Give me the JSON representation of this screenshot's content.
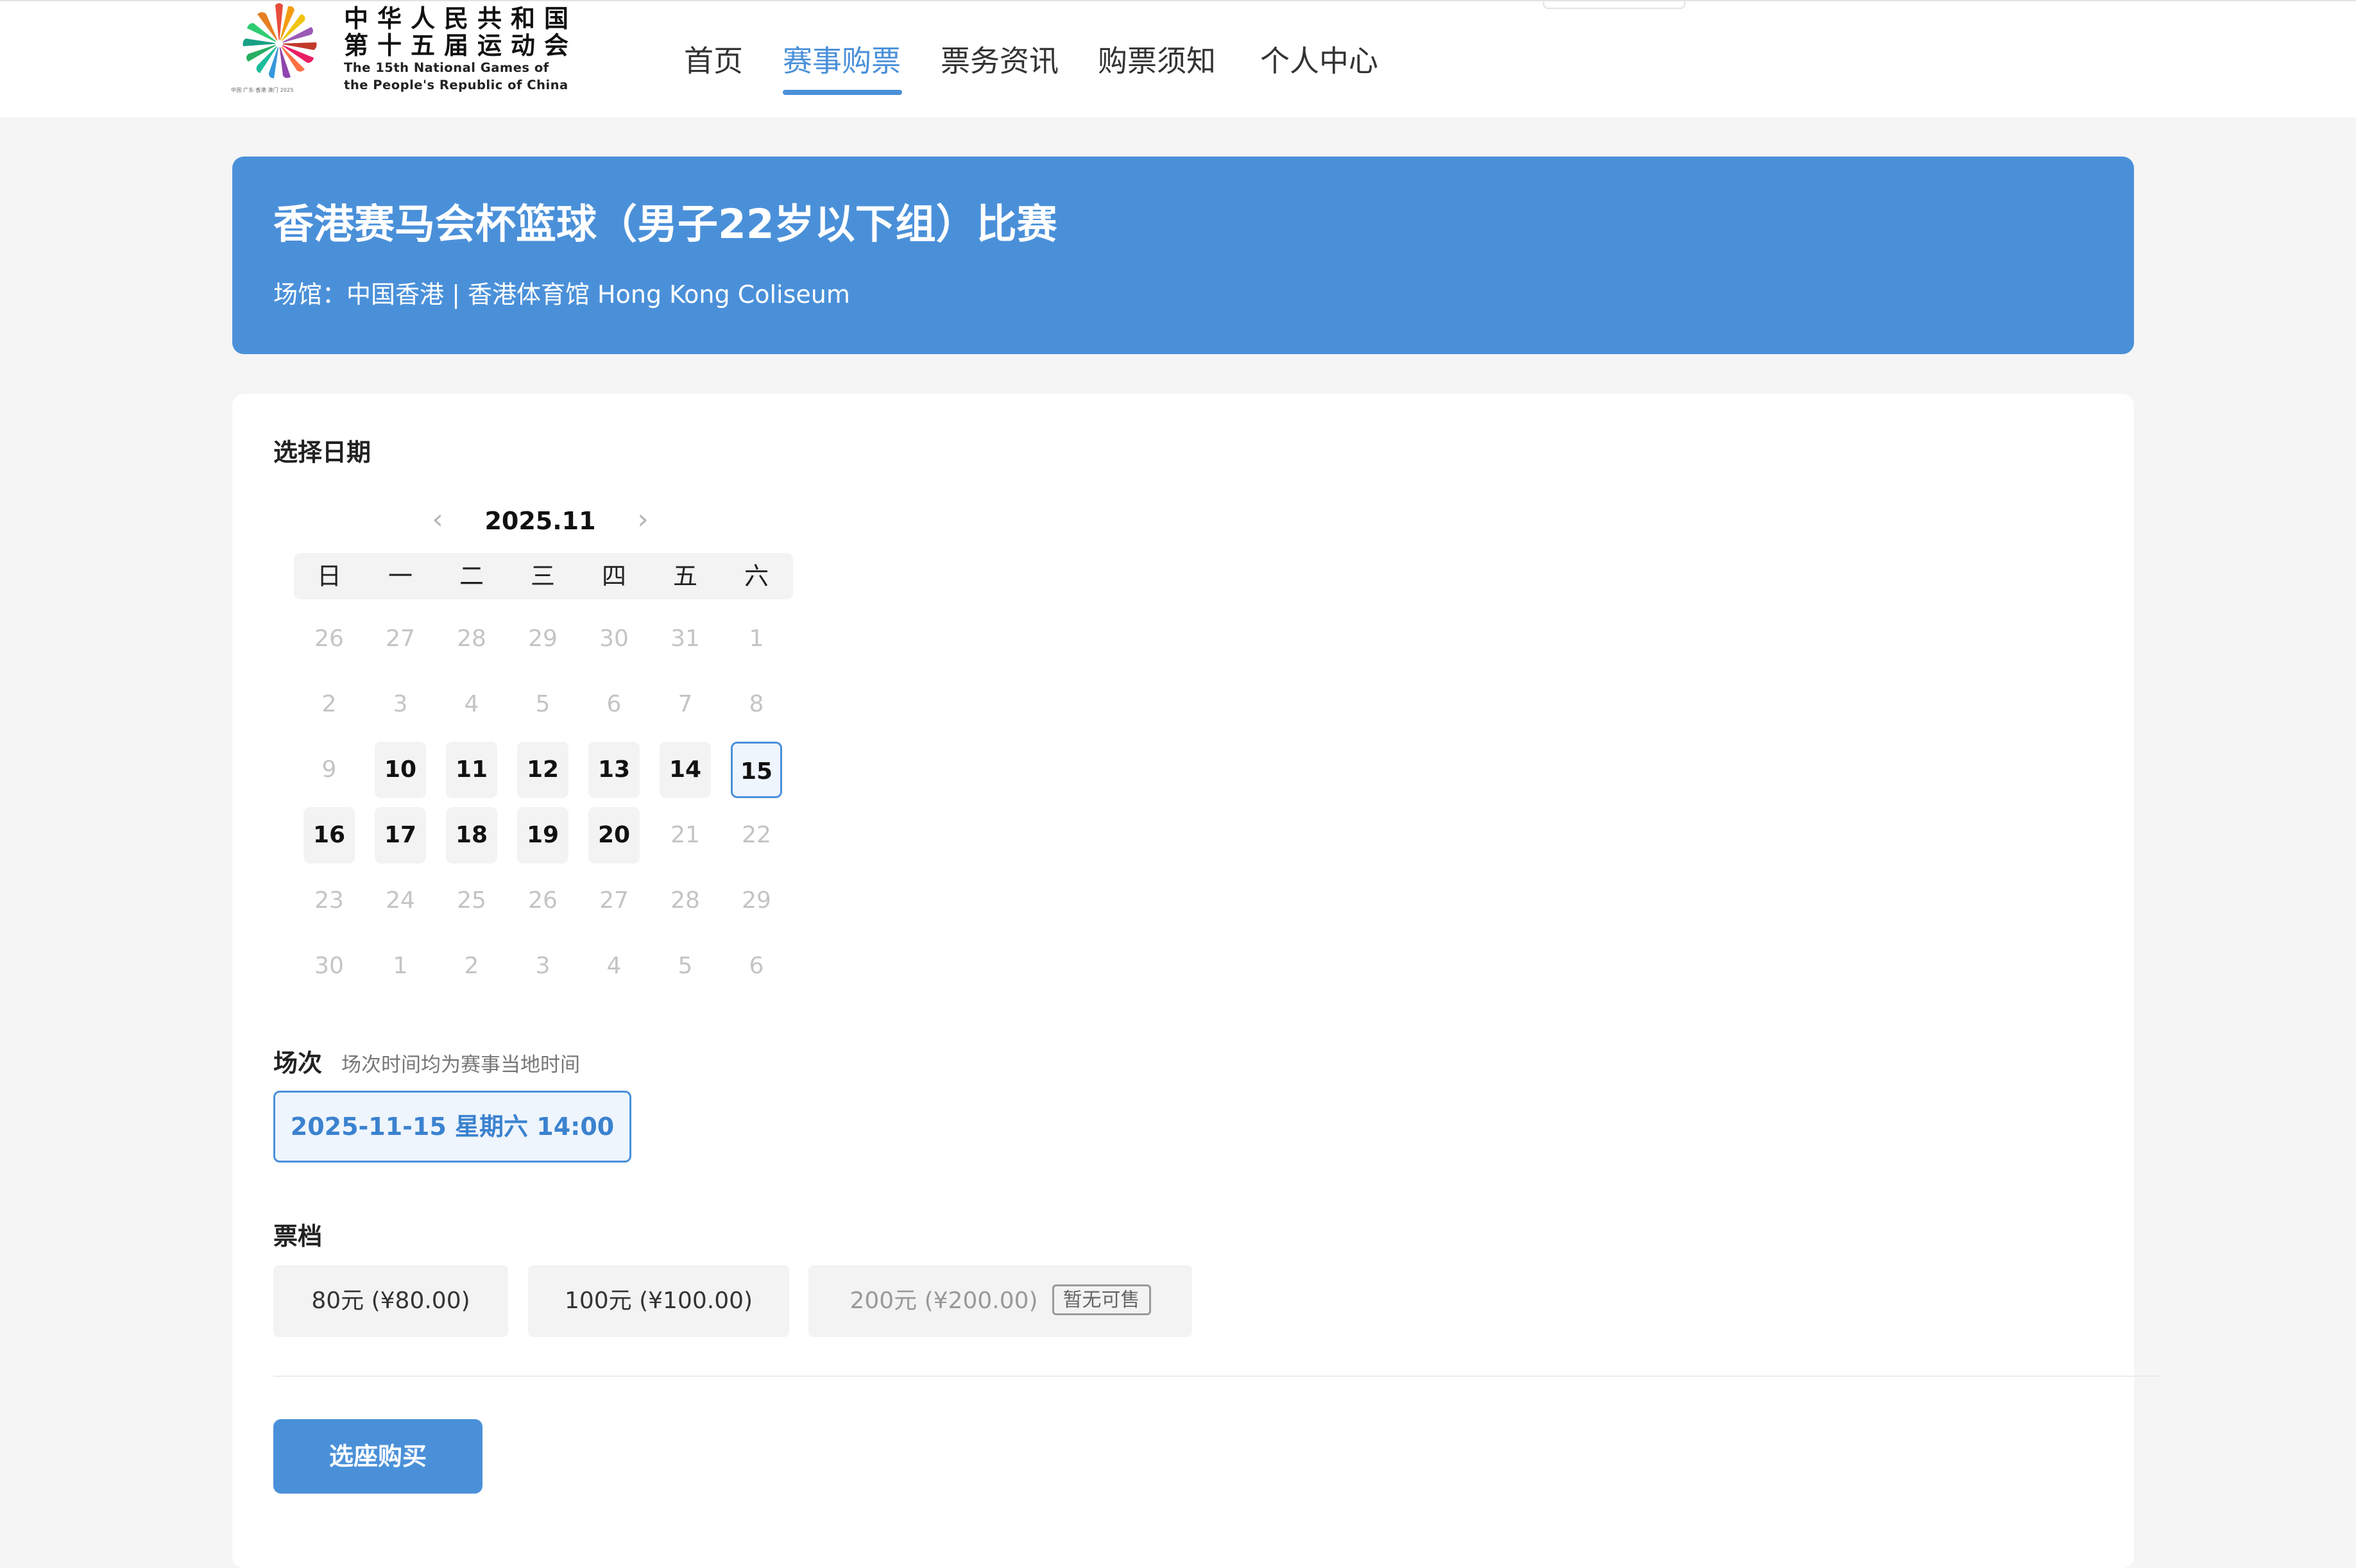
{
  "logo": {
    "title_cn_line1": "中华人民共和国",
    "title_cn_line2": "第十五届运动会",
    "title_en_line1": "The 15th National Games of",
    "title_en_line2": "the People's Republic of China",
    "caption": "中国 广东·香港·澳门 2025"
  },
  "nav": {
    "items": [
      {
        "label": "首页"
      },
      {
        "label": "赛事购票"
      },
      {
        "label": "票务资讯"
      },
      {
        "label": "购票须知"
      },
      {
        "label": "个人中心"
      }
    ],
    "active_index": 1
  },
  "event": {
    "title": "香港赛马会杯篮球（男子22岁以下组）比赛",
    "venue": "场馆：中国香港 | 香港体育馆 Hong Kong Coliseum"
  },
  "date_section": {
    "label": "选择日期",
    "month": "2025.11",
    "weekdays": [
      "日",
      "一",
      "二",
      "三",
      "四",
      "五",
      "六"
    ],
    "weeks": [
      [
        "26",
        "27",
        "28",
        "29",
        "30",
        "31",
        "1"
      ],
      [
        "2",
        "3",
        "4",
        "5",
        "6",
        "7",
        "8"
      ],
      [
        "9",
        "10",
        "11",
        "12",
        "13",
        "14",
        "15"
      ],
      [
        "16",
        "17",
        "18",
        "19",
        "20",
        "21",
        "22"
      ],
      [
        "23",
        "24",
        "25",
        "26",
        "27",
        "28",
        "29"
      ],
      [
        "30",
        "1",
        "2",
        "3",
        "4",
        "5",
        "6"
      ]
    ],
    "available_days": [
      "10",
      "11",
      "12",
      "13",
      "14",
      "15",
      "16",
      "17",
      "18",
      "19",
      "20"
    ],
    "selected_day": "15"
  },
  "session_section": {
    "label": "场次",
    "hint": "场次时间均为赛事当地时间",
    "selected": "2025-11-15 星期六 14:00"
  },
  "tier_section": {
    "label": "票档",
    "tiers": [
      {
        "label": "80元 (¥80.00)"
      },
      {
        "label": "100元 (¥100.00)"
      },
      {
        "label": "200元 (¥200.00)",
        "badge": "暂无可售"
      }
    ]
  },
  "buy_button": "选座购买",
  "colors": {
    "accent": "#4a90d9",
    "accent_light": "#eef5fd",
    "page_bg": "#f5f5f5"
  }
}
